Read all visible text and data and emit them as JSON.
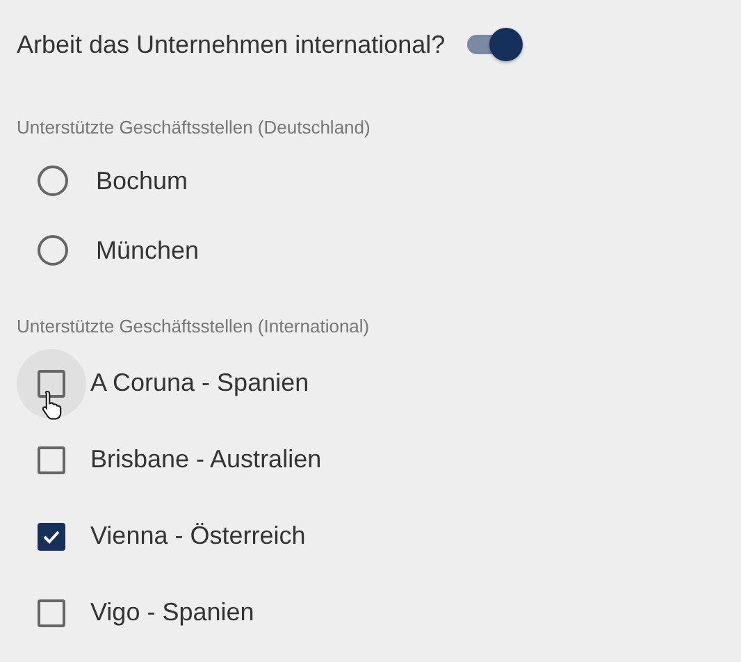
{
  "toggle": {
    "label": "Arbeit das Unternehmen international?",
    "on": true
  },
  "germany": {
    "label": "Unterstützte Geschäftsstellen (Deutschland)",
    "options": [
      {
        "label": "Bochum",
        "selected": false
      },
      {
        "label": "München",
        "selected": false
      }
    ]
  },
  "international": {
    "label": "Unterstützte Geschäftsstellen (International)",
    "options": [
      {
        "label": "A Coruna - Spanien",
        "checked": false,
        "hovered": true
      },
      {
        "label": "Brisbane - Australien",
        "checked": false,
        "hovered": false
      },
      {
        "label": "Vienna - Österreich",
        "checked": true,
        "hovered": false
      },
      {
        "label": "Vigo - Spanien",
        "checked": false,
        "hovered": false
      }
    ]
  }
}
